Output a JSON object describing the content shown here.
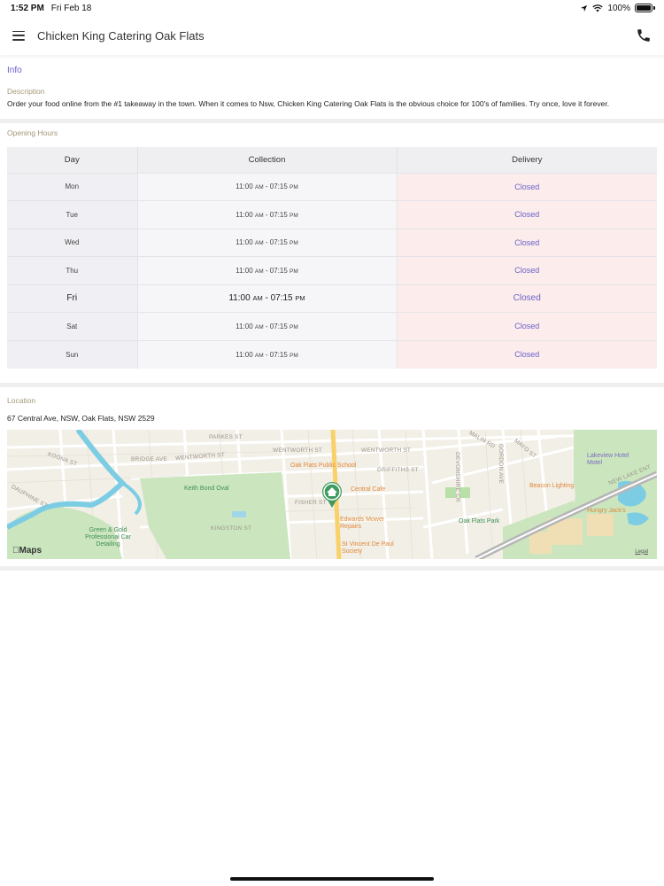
{
  "status_bar": {
    "time": "1:52 PM",
    "date": "Fri Feb 18",
    "battery_text": "100%",
    "battery_level": 1.0,
    "icons": [
      "location-arrow-icon",
      "wifi-icon",
      "battery-icon"
    ]
  },
  "header": {
    "title": "Chicken King Catering Oak Flats",
    "menu_icon": "hamburger-menu-icon",
    "phone_icon": "phone-icon"
  },
  "info": {
    "link_label": "Info",
    "description_label": "Description",
    "description_text": "Order your food online from the #1 takeaway in the town. When it comes to Nsw, Chicken King Catering Oak Flats is the obvious choice for 100's of families. Try once, love it forever."
  },
  "opening_hours": {
    "label": "Opening Hours",
    "columns": [
      "Day",
      "Collection",
      "Delivery"
    ],
    "rows": [
      {
        "day": "Mon",
        "open": "11:00",
        "open_ampm": "AM",
        "close": "07:15",
        "close_ampm": "PM",
        "delivery": "Closed"
      },
      {
        "day": "Tue",
        "open": "11:00",
        "open_ampm": "AM",
        "close": "07:15",
        "close_ampm": "PM",
        "delivery": "Closed"
      },
      {
        "day": "Wed",
        "open": "11:00",
        "open_ampm": "AM",
        "close": "07:15",
        "close_ampm": "PM",
        "delivery": "Closed"
      },
      {
        "day": "Thu",
        "open": "11:00",
        "open_ampm": "AM",
        "close": "07:15",
        "close_ampm": "PM",
        "delivery": "Closed"
      },
      {
        "day": "Fri",
        "open": "11:00",
        "open_ampm": "AM",
        "close": "07:15",
        "close_ampm": "PM",
        "delivery": "Closed"
      },
      {
        "day": "Sat",
        "open": "11:00",
        "open_ampm": "AM",
        "close": "07:15",
        "close_ampm": "PM",
        "delivery": "Closed"
      },
      {
        "day": "Sun",
        "open": "11:00",
        "open_ampm": "AM",
        "close": "07:15",
        "close_ampm": "PM",
        "delivery": "Closed"
      }
    ],
    "highlighted_day": "Fri",
    "time_separator": " - "
  },
  "location": {
    "label": "Location",
    "address": "67 Central Ave, NSW, Oak Flats, NSW 2529",
    "map": {
      "streets": [
        "PARKES ST",
        "WENTWORTH ST",
        "WENTWORTH ST",
        "BRIDGE AVE",
        "KOONA ST",
        "GRIFFITHS ST",
        "MALIN RD",
        "FISHER ST",
        "KINGSTON ST",
        "DEVONSHIRE CR",
        "GORDON AVE",
        "NEW LAKE ENT",
        "DAUPHINE ST",
        "MAYO ST"
      ],
      "pois": [
        {
          "name": "Oak Flats Public School",
          "color": "orange"
        },
        {
          "name": "Central Cafe",
          "color": "orange"
        },
        {
          "name": "Keith Bond Oval",
          "color": "green"
        },
        {
          "name": "Edwards Mower Repairs",
          "color": "orange"
        },
        {
          "name": "St Vincent De Paul Society",
          "color": "orange"
        },
        {
          "name": "Oak Flats Park",
          "color": "green"
        },
        {
          "name": "Green & Gold Professional Car Detailing",
          "color": "green"
        },
        {
          "name": "Lakeview Hotel Motel",
          "color": "purple"
        },
        {
          "name": "Beacon Lighting",
          "color": "orange"
        },
        {
          "name": "Hungry Jack's",
          "color": "orange"
        }
      ],
      "attribution": "Maps",
      "legal": "Legal",
      "pin_icon": "home-pin-icon"
    }
  }
}
